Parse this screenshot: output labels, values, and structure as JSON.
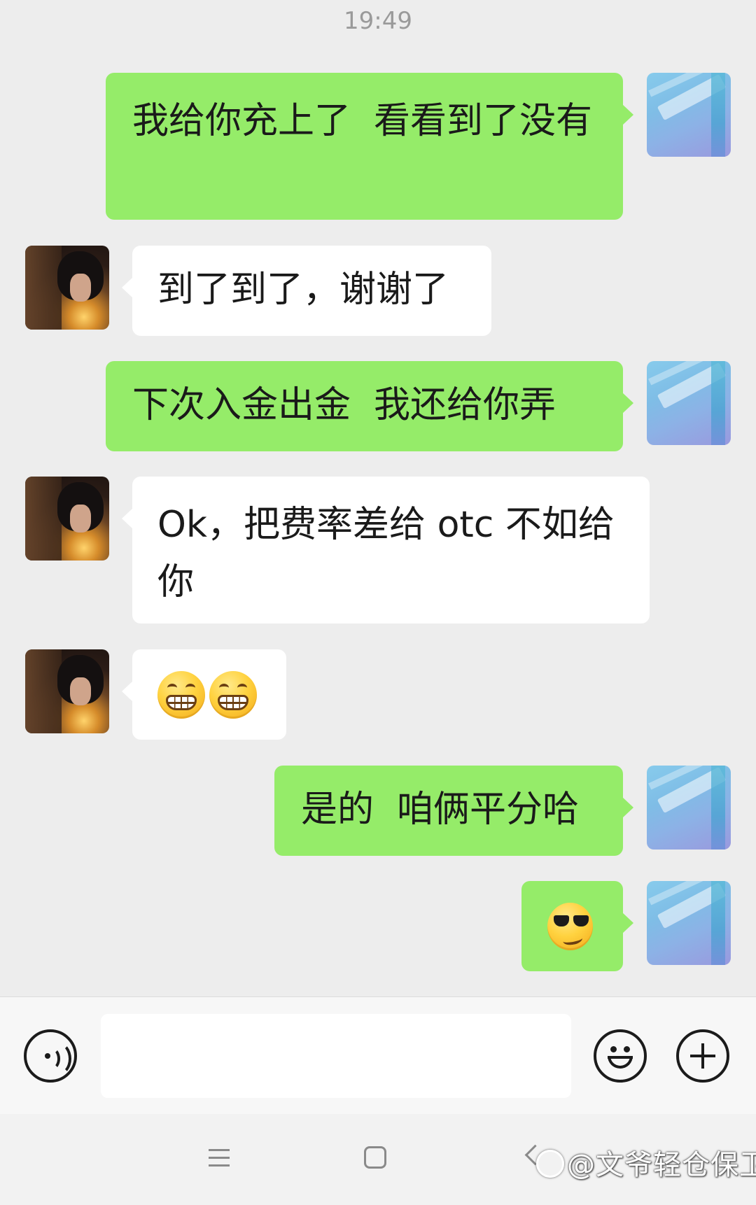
{
  "status": {
    "timestamp": "19:49"
  },
  "messages": [
    {
      "side": "right",
      "text": "我给你充上了  看看到了没有"
    },
    {
      "side": "left",
      "text": "到了到了，谢谢了"
    },
    {
      "side": "right",
      "text": "下次入金出金  我还给你弄"
    },
    {
      "side": "left",
      "text": "Ok，把费率差给 otc 不如给你"
    },
    {
      "side": "left",
      "emojis": [
        "grin-emoji",
        "grin-emoji"
      ]
    },
    {
      "side": "right",
      "text": "是的  咱俩平分哈"
    },
    {
      "side": "right",
      "emojis": [
        "cool-sunglasses-emoji"
      ]
    }
  ],
  "input_bar": {
    "input_value": "",
    "icons": [
      "voice-icon",
      "emoji-icon",
      "plus-icon"
    ]
  },
  "navbar": {
    "icons": [
      "menu-icon",
      "home-icon",
      "back-icon"
    ]
  },
  "watermark": {
    "text": "@文爷轻仓保卫"
  },
  "colors": {
    "background": "#ededed",
    "outgoing_bubble": "#95ec69",
    "incoming_bubble": "#ffffff",
    "timestamp": "#9a9a9a"
  }
}
